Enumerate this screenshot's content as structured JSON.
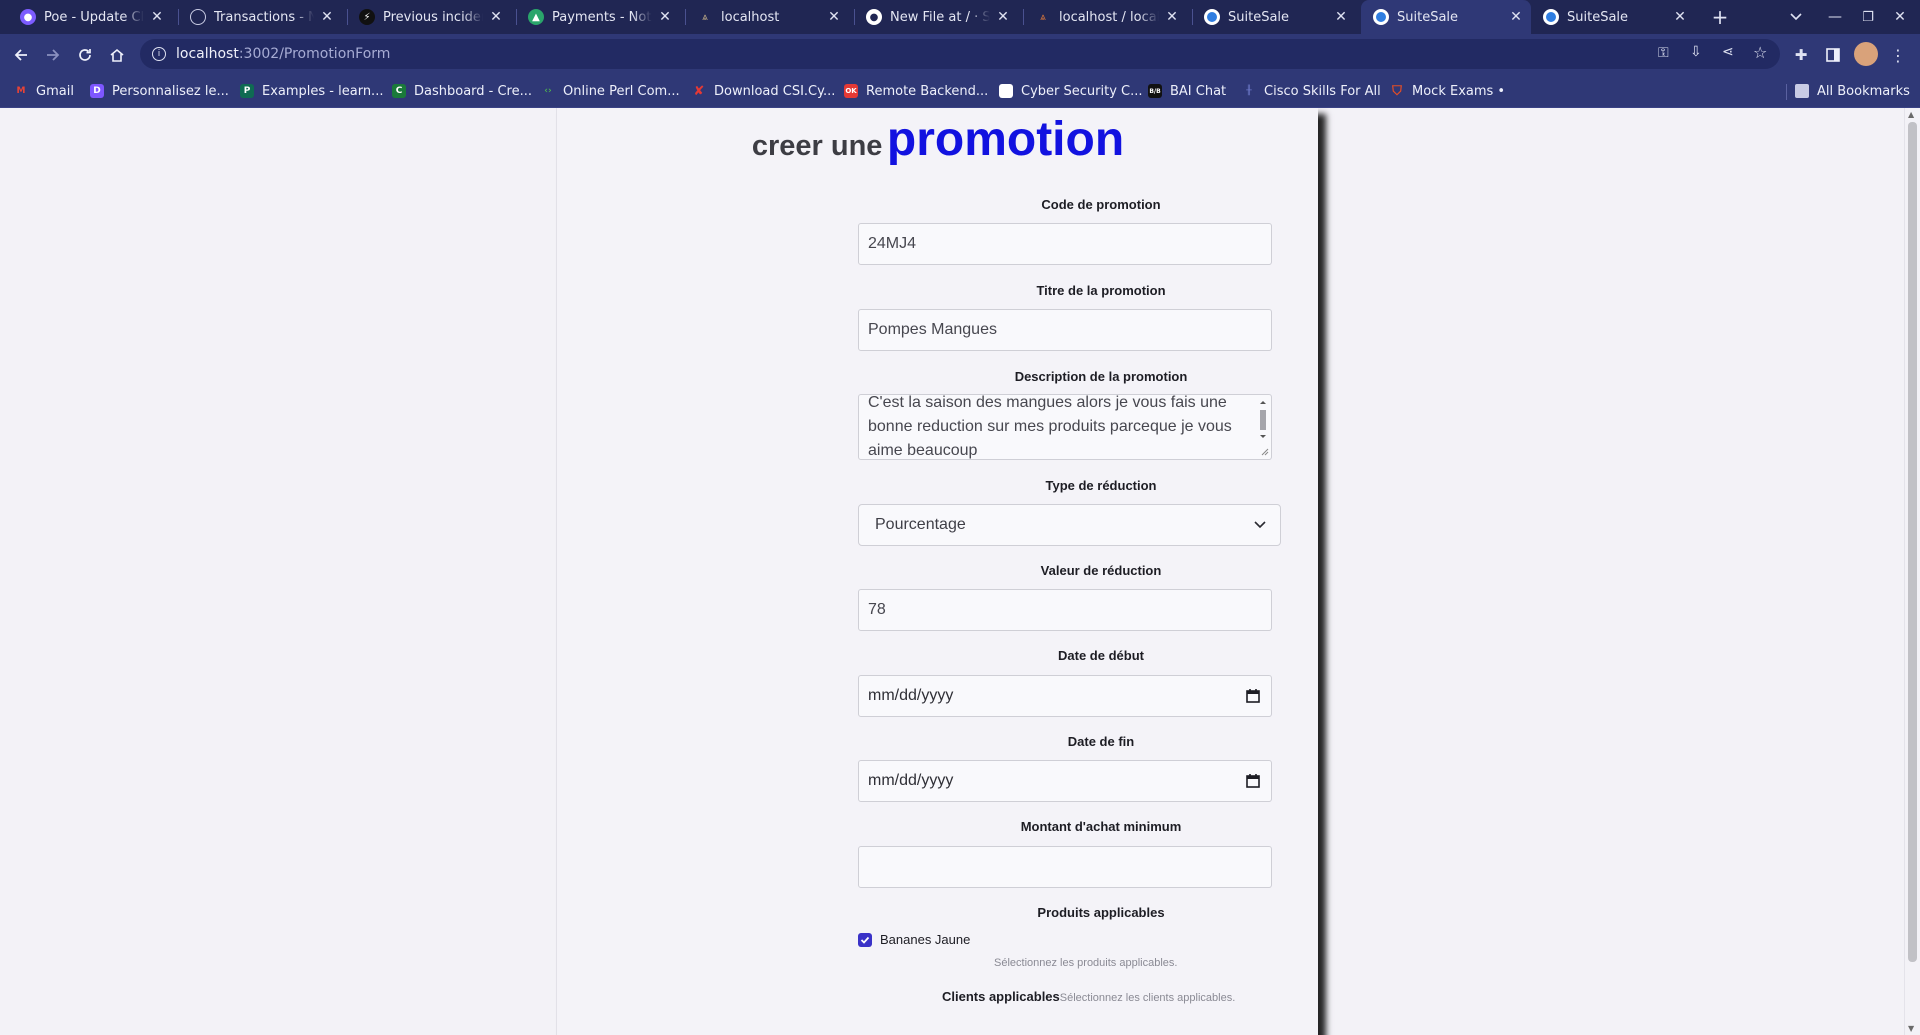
{
  "browser": {
    "tabs": [
      {
        "title": "Poe - Update Clie",
        "icon": "poe-icon",
        "color": "#7c5cff"
      },
      {
        "title": "Transactions - No",
        "icon": "globe-icon",
        "color": "#8a8fb8"
      },
      {
        "title": "Previous incident",
        "icon": "bolt-icon",
        "color": "#111111"
      },
      {
        "title": "Payments - Notch",
        "icon": "triangle-logo-icon",
        "color": "#2aa56b"
      },
      {
        "title": "localhost",
        "icon": "phpmyadmin-icon",
        "color": "#c9b48a"
      },
      {
        "title": "New File at / · Se",
        "icon": "github-icon",
        "color": "#ffffff"
      },
      {
        "title": "localhost / localh",
        "icon": "phpmyadmin-icon",
        "color": "#e27b3b"
      },
      {
        "title": "SuiteSale",
        "icon": "suitesale-icon",
        "color": "#2f7de1"
      },
      {
        "title": "SuiteSale",
        "icon": "suitesale-icon",
        "color": "#2f7de1"
      },
      {
        "title": "SuiteSale",
        "icon": "suitesale-icon",
        "color": "#2f7de1"
      }
    ],
    "active_tab_index": 8,
    "url_host": "localhost",
    "url_path": ":3002/PromotionForm",
    "bookmarks": [
      {
        "label": "Gmail",
        "icon": "gmail-icon",
        "color": "#ea4335"
      },
      {
        "label": "Personnalisez le...",
        "icon": "d-logo-icon",
        "color": "#7e57ff"
      },
      {
        "label": "Examples - learn...",
        "icon": "p-logo-icon",
        "color": "#0f6b52"
      },
      {
        "label": "Dashboard - Cre...",
        "icon": "c-logo-icon",
        "color": "#1a7a3a"
      },
      {
        "label": "Online Perl Com...",
        "icon": "code-icon",
        "color": "#4caf50"
      },
      {
        "label": "Download CSI.Cy...",
        "icon": "x-logo-icon",
        "color": "#e53935"
      },
      {
        "label": "Remote Backend...",
        "icon": "ok-logo-icon",
        "color": "#e53935"
      },
      {
        "label": "Cyber Security C...",
        "icon": "doc-icon",
        "color": "#ffffff"
      },
      {
        "label": "BAI Chat",
        "icon": "bai-icon",
        "color": "#111111"
      },
      {
        "label": "Cisco Skills For All",
        "icon": "cisco-icon",
        "color": "#6c78c8"
      },
      {
        "label": "Mock Exams •",
        "icon": "shield-icon",
        "color": "#e44d26"
      }
    ],
    "all_bookmarks_label": "All Bookmarks"
  },
  "page": {
    "title_small": "creer une",
    "title_big": "promotion",
    "accent_color": "#1212e0",
    "fields": {
      "code": {
        "label": "Code de promotion",
        "value": "24MJ4"
      },
      "title": {
        "label": "Titre de la promotion",
        "value": "Pompes Mangues"
      },
      "description": {
        "label": "Description de la promotion",
        "value": "C'est la saison des mangues alors je vous fais une bonne reduction sur mes produits parceque je vous aime beaucoup"
      },
      "discount_type": {
        "label": "Type de réduction",
        "value": "Pourcentage"
      },
      "discount_value": {
        "label": "Valeur de réduction",
        "value": "78"
      },
      "start_date": {
        "label": "Date de début",
        "value": "mm/dd/yyyy"
      },
      "end_date": {
        "label": "Date de fin",
        "value": "mm/dd/yyyy"
      },
      "min_amount": {
        "label": "Montant d'achat minimum",
        "value": ""
      },
      "products": {
        "label": "Produits applicables",
        "items": [
          {
            "name": "Bananes Jaune",
            "checked": true
          }
        ],
        "hint": "Sélectionnez les produits applicables."
      },
      "clients": {
        "label": "Clients applicables",
        "hint": "Sélectionnez les clients applicables."
      }
    }
  }
}
